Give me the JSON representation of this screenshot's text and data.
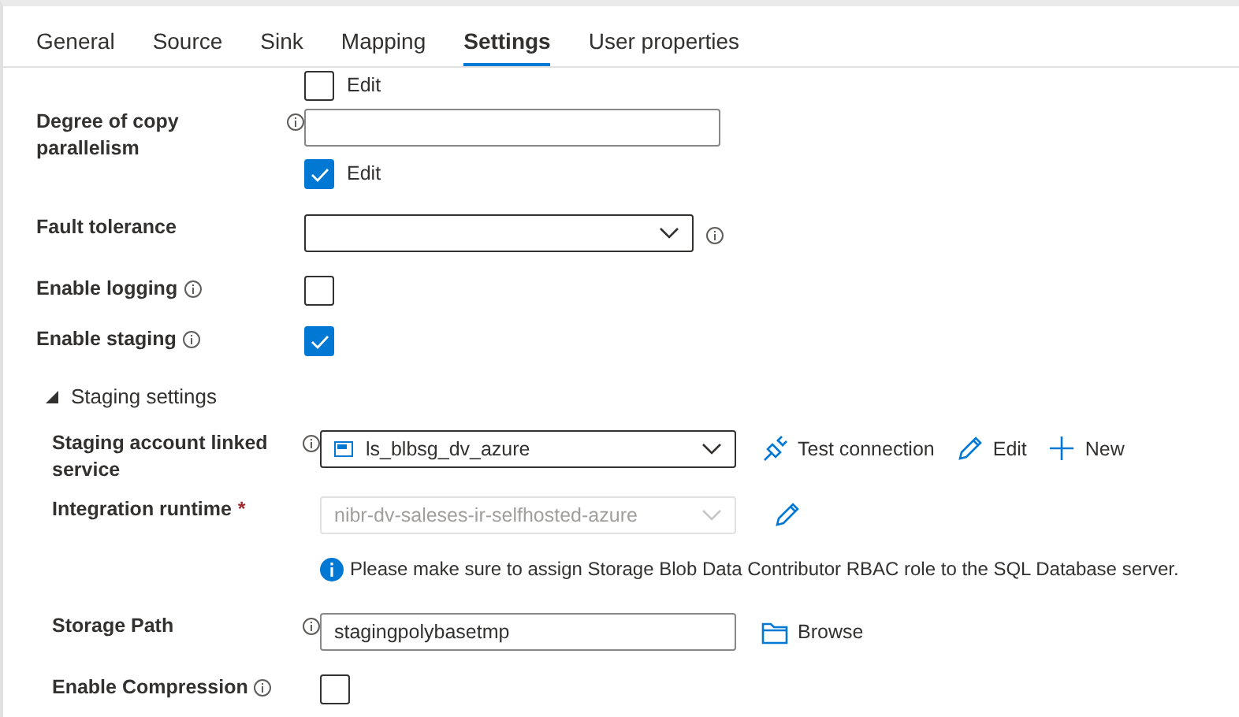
{
  "tabs": [
    {
      "label": "General",
      "selected": false
    },
    {
      "label": "Source",
      "selected": false
    },
    {
      "label": "Sink",
      "selected": false
    },
    {
      "label": "Mapping",
      "selected": false
    },
    {
      "label": "Settings",
      "selected": true
    },
    {
      "label": "User properties",
      "selected": false
    }
  ],
  "top_edit": {
    "label": "Edit",
    "checked": false
  },
  "settings": [
    {
      "kind": "text",
      "label": "Degree of copy parallelism",
      "info": true,
      "edit": {
        "label": "Edit",
        "checked": true
      }
    },
    {
      "kind": "select",
      "label": "Fault tolerance",
      "info_after": true
    },
    {
      "kind": "checkbox",
      "label": "Enable logging",
      "info": true,
      "checked": false
    },
    {
      "kind": "checkbox",
      "label": "Enable staging",
      "info": true,
      "checked": true
    }
  ],
  "staging": {
    "label": "Staging settings",
    "expanded": true,
    "fields": [
      {
        "kind": "select",
        "label": "Staging account linked service",
        "info": true,
        "value": "ls_blbsg_dv_azure",
        "disabled": false,
        "actions": [
          {
            "kind": "test",
            "label": "Test connection"
          },
          {
            "kind": "edit",
            "label": "Edit"
          },
          {
            "kind": "new",
            "label": "New"
          }
        ]
      },
      {
        "kind": "select",
        "label": "Integration runtime",
        "required_mark": "*",
        "value": "nibr-dv-saleses-ir-selfhosted-azure",
        "disabled": true,
        "actions": [
          {
            "kind": "edit"
          }
        ]
      },
      {
        "kind": "note",
        "text": "Please make sure to assign Storage Blob Data Contributor RBAC role to the SQL Database server."
      },
      {
        "kind": "text",
        "label": "Storage Path",
        "info": true,
        "value": "stagingpolybasetmp",
        "actions": [
          {
            "kind": "browse",
            "label": "Browse"
          }
        ]
      },
      {
        "kind": "checkbox",
        "label": "Enable Compression",
        "info": true,
        "checked": false
      }
    ]
  }
}
